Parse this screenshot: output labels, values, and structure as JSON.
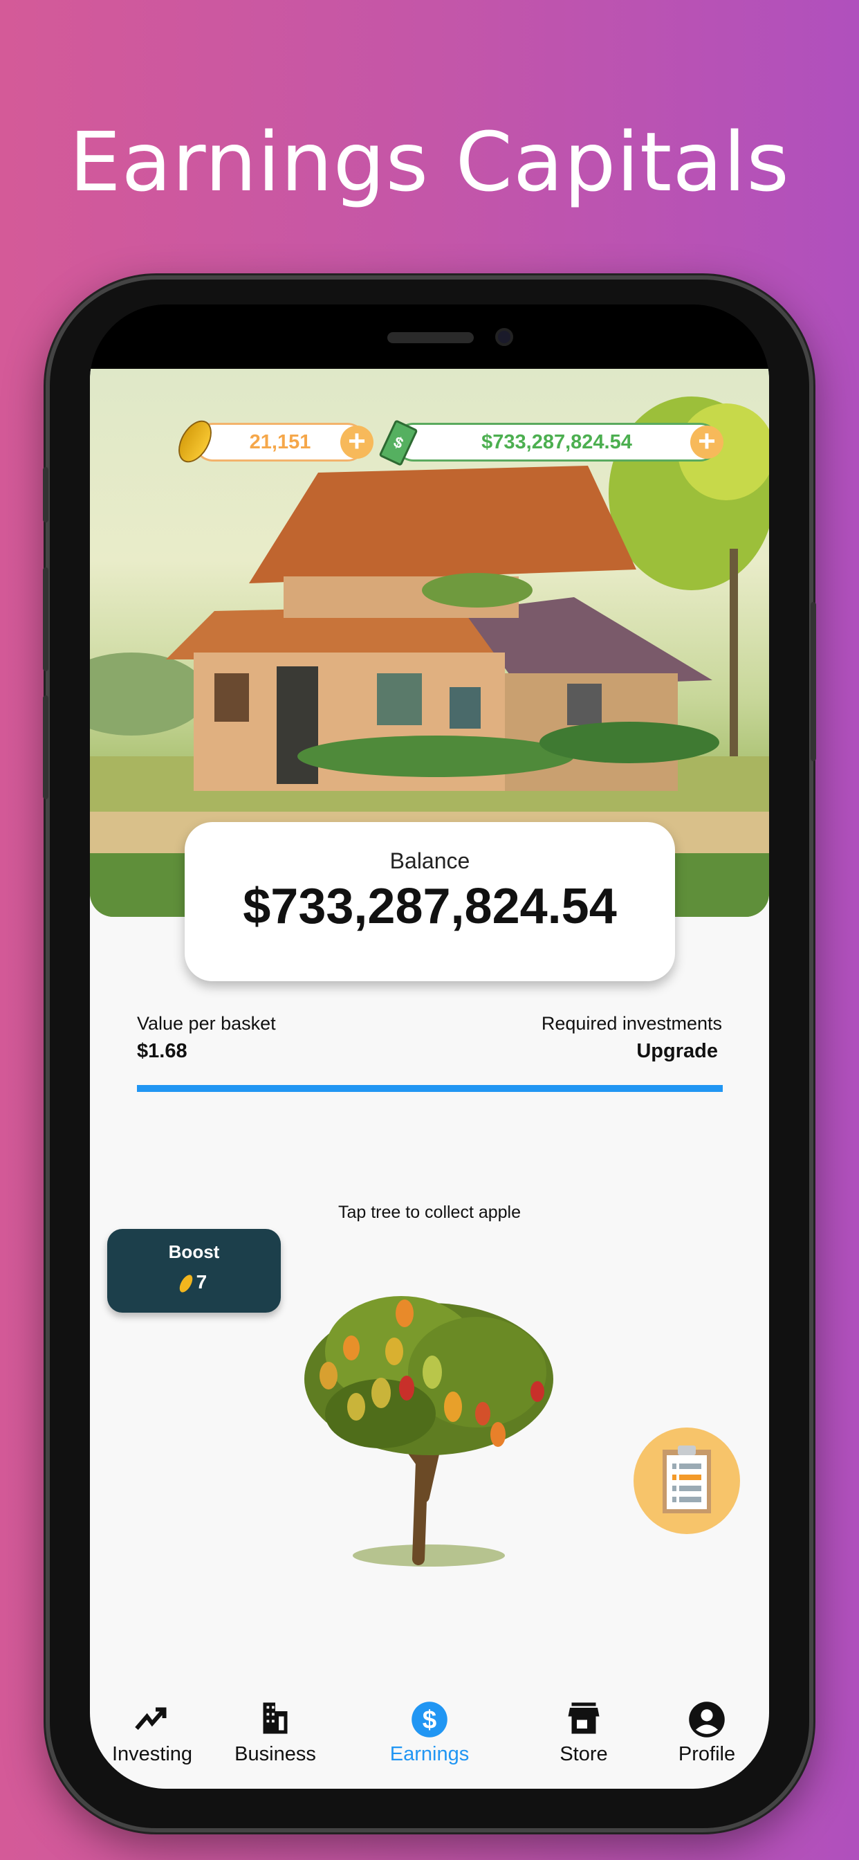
{
  "headline": "Earnings Capitals",
  "topbar": {
    "coins": "21,151",
    "cash": "$733,287,824.54",
    "coin_icon": "gold-coin-icon",
    "cash_icon": "banknote-icon",
    "plus_icon": "plus-icon"
  },
  "balance": {
    "label": "Balance",
    "value": "$733,287,824.54"
  },
  "stats": {
    "value_label": "Value per basket",
    "value": "$1.68",
    "req_label": "Required investments",
    "req_action": "Upgrade",
    "progress": 1.0
  },
  "game": {
    "hint": "Tap tree to collect apple",
    "boost_label": "Boost",
    "boost_cost": "7"
  },
  "colors": {
    "accent": "#2196f3",
    "coin": "#f5a74a",
    "cash": "#4caf50",
    "boost_bg": "#1c3f4b"
  },
  "nav": {
    "active": "Earnings",
    "items": [
      {
        "label": "Investing",
        "icon": "trending-up-icon"
      },
      {
        "label": "Business",
        "icon": "building-icon"
      },
      {
        "label": "Earnings",
        "icon": "dollar-circle-icon"
      },
      {
        "label": "Store",
        "icon": "store-icon"
      },
      {
        "label": "Profile",
        "icon": "account-circle-icon"
      }
    ]
  }
}
